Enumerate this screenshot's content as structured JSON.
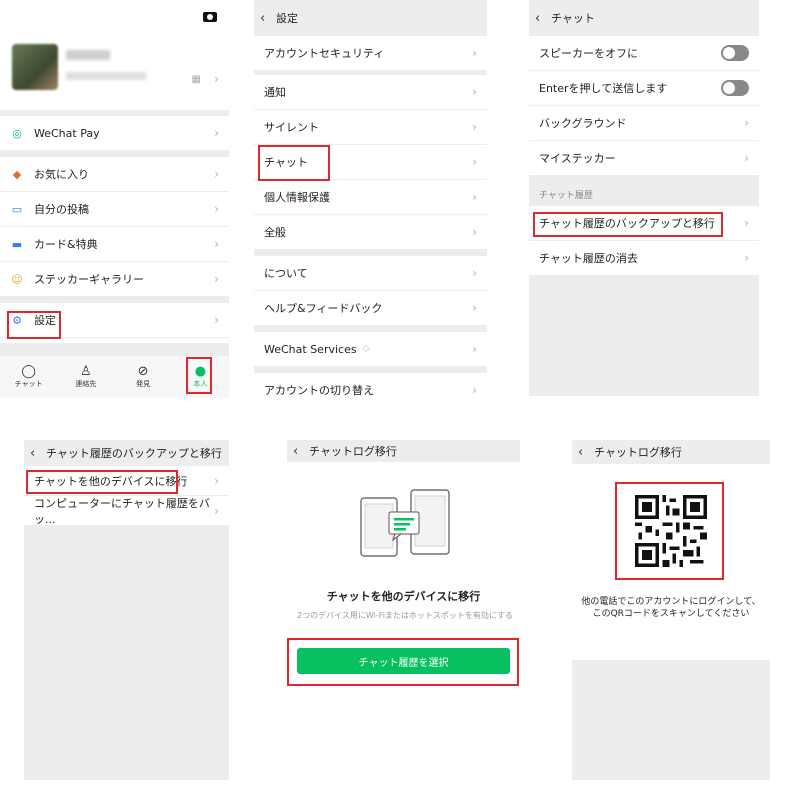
{
  "panel1": {
    "profile_name": "",
    "wechat_id": "",
    "menu": [
      {
        "label": "WeChat Pay",
        "icon": "wechat-pay-icon"
      },
      {
        "label": "お気に入り",
        "icon": "favorites-cube-icon"
      },
      {
        "label": "自分の投稿",
        "icon": "moments-photo-icon"
      },
      {
        "label": "カード&特典",
        "icon": "card-icon"
      },
      {
        "label": "ステッカーギャラリー",
        "icon": "sticker-smile-icon"
      },
      {
        "label": "設定",
        "icon": "settings-gear-icon"
      }
    ],
    "tabs": [
      {
        "label": "チャット",
        "icon": "chat-bubble-icon"
      },
      {
        "label": "連絡先",
        "icon": "contacts-icon"
      },
      {
        "label": "発見",
        "icon": "discover-compass-icon"
      },
      {
        "label": "本人",
        "icon": "me-person-icon"
      }
    ]
  },
  "panel2": {
    "title": "設定",
    "items": [
      "アカウントセキュリティ",
      "通知",
      "サイレント",
      "チャット",
      "個人情報保護",
      "全般",
      "について",
      "ヘルプ&フィードバック",
      "WeChat Services",
      "アカウントの切り替え"
    ]
  },
  "panel3": {
    "title": "チャット",
    "items": [
      "スピーカーをオフに",
      "Enterを押して送信します",
      "バックグラウンド",
      "マイステッカー"
    ],
    "section": "チャット履歴",
    "history_items": [
      "チャット履歴のバックアップと移行",
      "チャット履歴の消去"
    ]
  },
  "panel4": {
    "title": "チャット履歴のバックアップと移行",
    "items": [
      "チャットを他のデバイスに移行",
      "コンピューターにチャット履歴をバッ..."
    ]
  },
  "panel5": {
    "title": "チャットログ移行",
    "heading": "チャットを他のデバイスに移行",
    "description": "2つのデバイス用にWi-Fiまたはホットスポットを有効にする",
    "button": "チャット履歴を選択"
  },
  "panel6": {
    "title": "チャットログ移行",
    "message": "他の電話でこのアカウントにログインして、このQRコードをスキャンしてください"
  },
  "colors": {
    "accent": "#07c160",
    "highlight": "#e0262e",
    "background": "#ededed"
  }
}
